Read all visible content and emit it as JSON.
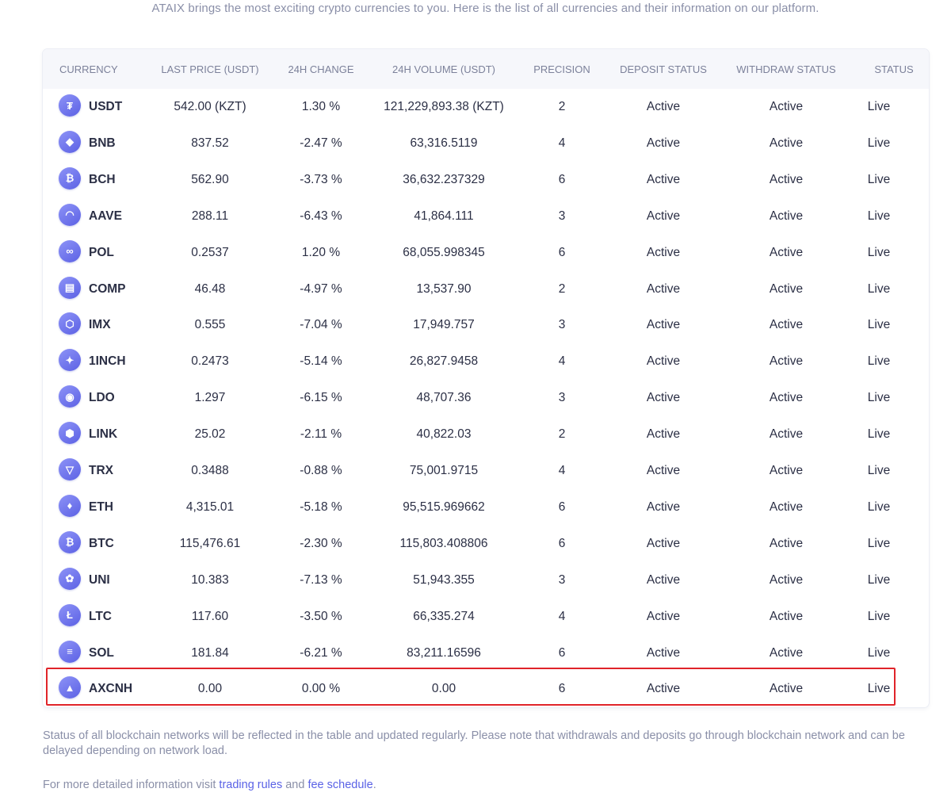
{
  "intro_text": "ATAIX brings the most exciting crypto currencies to you. Here is the list of all currencies and their information on our platform.",
  "columns": [
    "CURRENCY",
    "LAST PRICE (USDT)",
    "24H CHANGE",
    "24H VOLUME (USDT)",
    "PRECISION",
    "DEPOSIT STATUS",
    "WITHDRAW STATUS",
    "STATUS"
  ],
  "rows": [
    {
      "currency": "USDT",
      "icon": "tether-icon",
      "glyph": "₮",
      "price": "542.00 (KZT)",
      "change": "1.30 %",
      "volume": "121,229,893.38 (KZT)",
      "precision": "2",
      "deposit": "Active",
      "withdraw": "Active",
      "status": "Live"
    },
    {
      "currency": "BNB",
      "icon": "bnb-icon",
      "glyph": "◆",
      "price": "837.52",
      "change": "-2.47 %",
      "volume": "63,316.5119",
      "precision": "4",
      "deposit": "Active",
      "withdraw": "Active",
      "status": "Live"
    },
    {
      "currency": "BCH",
      "icon": "bitcoin-cash-icon",
      "glyph": "₿",
      "price": "562.90",
      "change": "-3.73 %",
      "volume": "36,632.237329",
      "precision": "6",
      "deposit": "Active",
      "withdraw": "Active",
      "status": "Live"
    },
    {
      "currency": "AAVE",
      "icon": "aave-icon",
      "glyph": "◠",
      "price": "288.11",
      "change": "-6.43 %",
      "volume": "41,864.111",
      "precision": "3",
      "deposit": "Active",
      "withdraw": "Active",
      "status": "Live"
    },
    {
      "currency": "POL",
      "icon": "polygon-icon",
      "glyph": "∞",
      "price": "0.2537",
      "change": "1.20 %",
      "volume": "68,055.998345",
      "precision": "6",
      "deposit": "Active",
      "withdraw": "Active",
      "status": "Live"
    },
    {
      "currency": "COMP",
      "icon": "compound-icon",
      "glyph": "▤",
      "price": "46.48",
      "change": "-4.97 %",
      "volume": "13,537.90",
      "precision": "2",
      "deposit": "Active",
      "withdraw": "Active",
      "status": "Live"
    },
    {
      "currency": "IMX",
      "icon": "immutable-x-icon",
      "glyph": "⬡",
      "price": "0.555",
      "change": "-7.04 %",
      "volume": "17,949.757",
      "precision": "3",
      "deposit": "Active",
      "withdraw": "Active",
      "status": "Live"
    },
    {
      "currency": "1INCH",
      "icon": "1inch-icon",
      "glyph": "✦",
      "price": "0.2473",
      "change": "-5.14 %",
      "volume": "26,827.9458",
      "precision": "4",
      "deposit": "Active",
      "withdraw": "Active",
      "status": "Live"
    },
    {
      "currency": "LDO",
      "icon": "lido-icon",
      "glyph": "◉",
      "price": "1.297",
      "change": "-6.15 %",
      "volume": "48,707.36",
      "precision": "3",
      "deposit": "Active",
      "withdraw": "Active",
      "status": "Live"
    },
    {
      "currency": "LINK",
      "icon": "chainlink-icon",
      "glyph": "⬢",
      "price": "25.02",
      "change": "-2.11 %",
      "volume": "40,822.03",
      "precision": "2",
      "deposit": "Active",
      "withdraw": "Active",
      "status": "Live"
    },
    {
      "currency": "TRX",
      "icon": "tron-icon",
      "glyph": "▽",
      "price": "0.3488",
      "change": "-0.88 %",
      "volume": "75,001.9715",
      "precision": "4",
      "deposit": "Active",
      "withdraw": "Active",
      "status": "Live"
    },
    {
      "currency": "ETH",
      "icon": "ethereum-icon",
      "glyph": "♦",
      "price": "4,315.01",
      "change": "-5.18 %",
      "volume": "95,515.969662",
      "precision": "6",
      "deposit": "Active",
      "withdraw": "Active",
      "status": "Live"
    },
    {
      "currency": "BTC",
      "icon": "bitcoin-icon",
      "glyph": "₿",
      "price": "115,476.61",
      "change": "-2.30 %",
      "volume": "115,803.408806",
      "precision": "6",
      "deposit": "Active",
      "withdraw": "Active",
      "status": "Live"
    },
    {
      "currency": "UNI",
      "icon": "uniswap-icon",
      "glyph": "✿",
      "price": "10.383",
      "change": "-7.13 %",
      "volume": "51,943.355",
      "precision": "3",
      "deposit": "Active",
      "withdraw": "Active",
      "status": "Live"
    },
    {
      "currency": "LTC",
      "icon": "litecoin-icon",
      "glyph": "Ł",
      "price": "117.60",
      "change": "-3.50 %",
      "volume": "66,335.274",
      "precision": "4",
      "deposit": "Active",
      "withdraw": "Active",
      "status": "Live"
    },
    {
      "currency": "SOL",
      "icon": "solana-icon",
      "glyph": "≡",
      "price": "181.84",
      "change": "-6.21 %",
      "volume": "83,211.16596",
      "precision": "6",
      "deposit": "Active",
      "withdraw": "Active",
      "status": "Live"
    },
    {
      "currency": "AXCNH",
      "icon": "axcnh-icon",
      "glyph": "▲",
      "price": "0.00",
      "change": "0.00 %",
      "volume": "0.00",
      "precision": "6",
      "deposit": "Active",
      "withdraw": "Active",
      "status": "Live"
    }
  ],
  "footnote": "Status of all blockchain networks will be reflected in the table and updated regularly. Please note that withdrawals and deposits go through blockchain network and can be delayed depending on network load.",
  "more_info": {
    "prefix": "For more detailed information visit ",
    "link1": "trading rules",
    "middle": " and ",
    "link2": "fee schedule",
    "suffix": "."
  },
  "colors": {
    "accent": "#5a62e6",
    "highlight_border": "#e0242a",
    "header_bg": "#f6f7fb"
  }
}
